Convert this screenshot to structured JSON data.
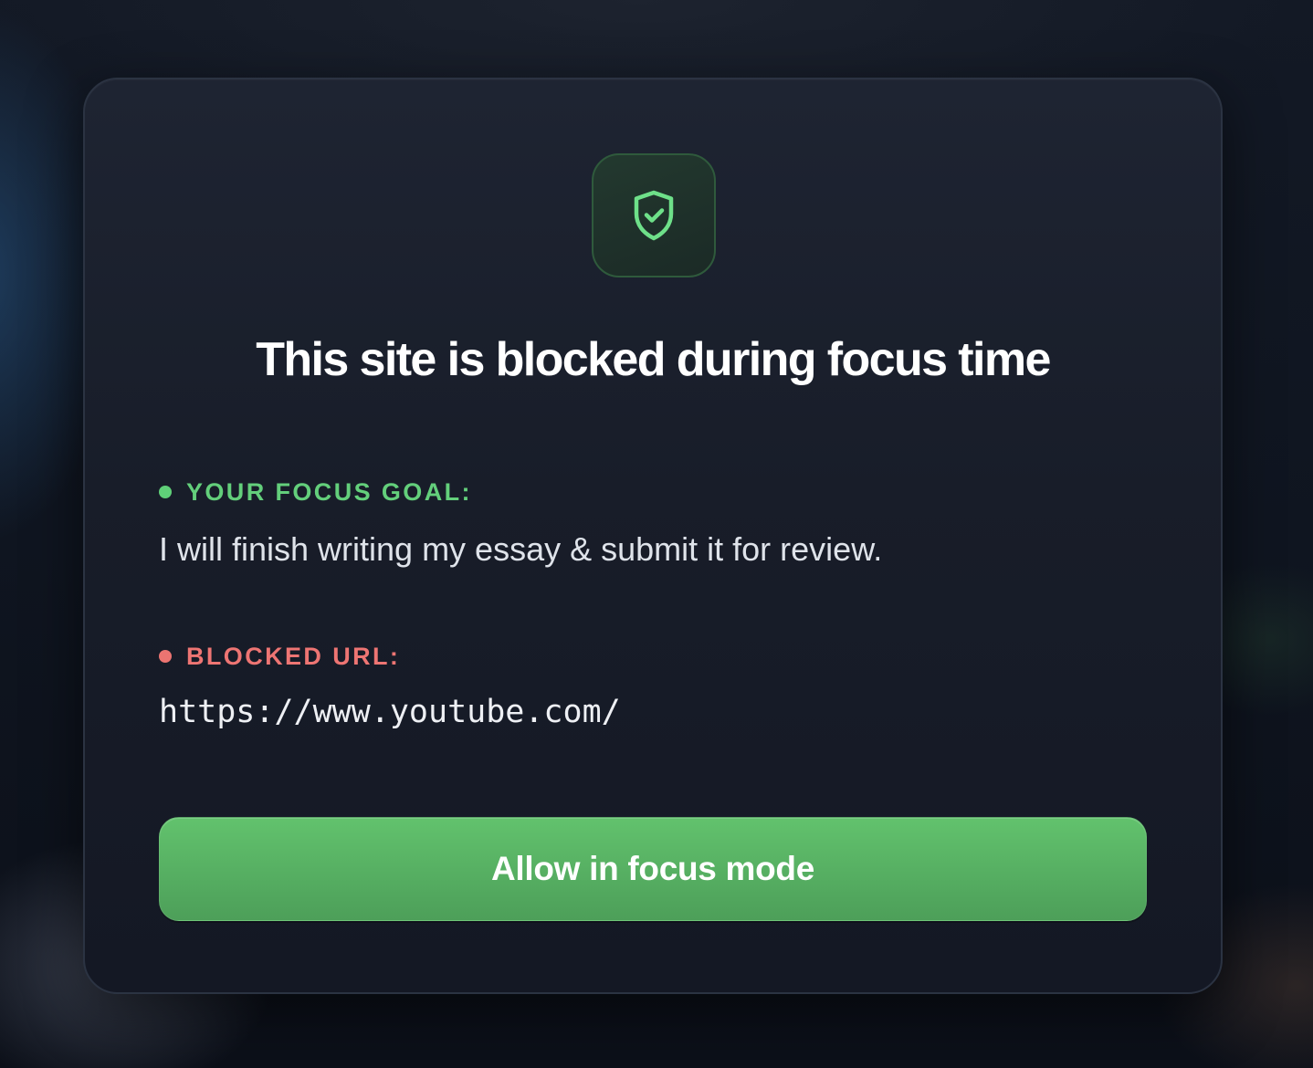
{
  "dialog": {
    "icon": "shield-check-icon",
    "title": "This site is blocked during focus time",
    "goal": {
      "label": "YOUR FOCUS GOAL:",
      "text": "I will finish writing my essay & submit it for review."
    },
    "blocked": {
      "label": "BLOCKED URL:",
      "url": "https://www.youtube.com/"
    },
    "allow_button_label": "Allow in focus mode"
  },
  "colors": {
    "accent_green": "#63cf7b",
    "accent_red": "#ee7573",
    "button_green": "#5bb766",
    "card_background": "#1a1f2c"
  }
}
